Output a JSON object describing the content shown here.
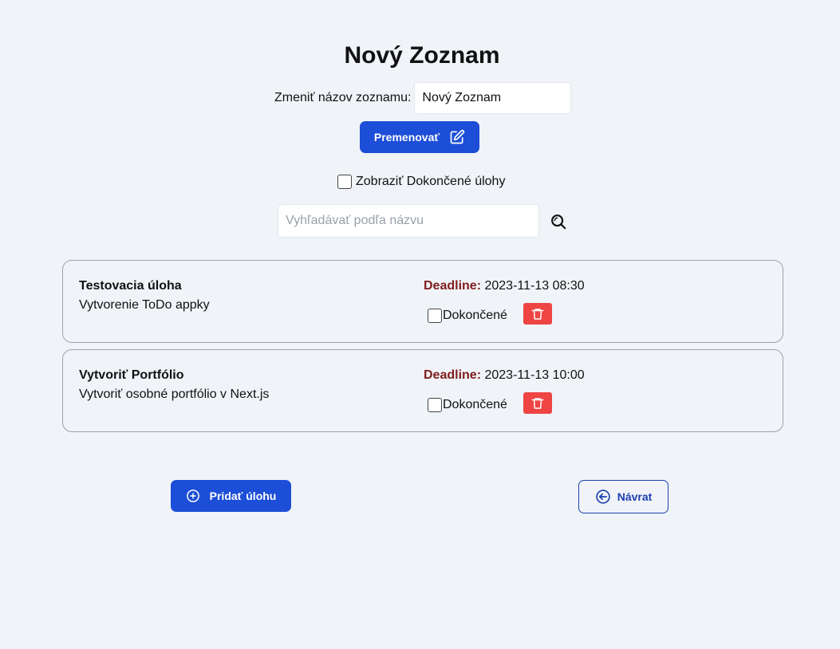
{
  "header": {
    "title": "Nový Zoznam"
  },
  "rename": {
    "label": "Zmeniť názov zoznamu:",
    "value": "Nový Zoznam",
    "button_label": "Premenovať"
  },
  "filter": {
    "show_done_label": "Zobraziť Dokončené úlohy",
    "show_done_checked": false
  },
  "search": {
    "placeholder": "Vyhľadávať podľa názvu"
  },
  "tasks": [
    {
      "name": "Testovacia úloha",
      "description": "Vytvorenie ToDo appky",
      "deadline_label": "Deadline:",
      "deadline": "2023-11-13 08:30",
      "done_label": "Dokončené",
      "done": false
    },
    {
      "name": "Vytvoriť Portfólio",
      "description": "Vytvoriť osobné portfólio v Next.js",
      "deadline_label": "Deadline:",
      "deadline": "2023-11-13 10:00",
      "done_label": "Dokončené",
      "done": false
    }
  ],
  "actions": {
    "add_label": "Pridať úlohu",
    "back_label": "Návrat"
  },
  "icons": {
    "rename": "edit-icon",
    "search": "search-icon",
    "delete": "trash-icon",
    "add": "plus-circle-icon",
    "back": "arrow-left-circle-icon"
  },
  "colors": {
    "background": "#f0f3f8",
    "primary": "#1d4ed8",
    "danger": "#ef4444",
    "deadline": "#7f1d1d",
    "outline": "#1e40af"
  }
}
